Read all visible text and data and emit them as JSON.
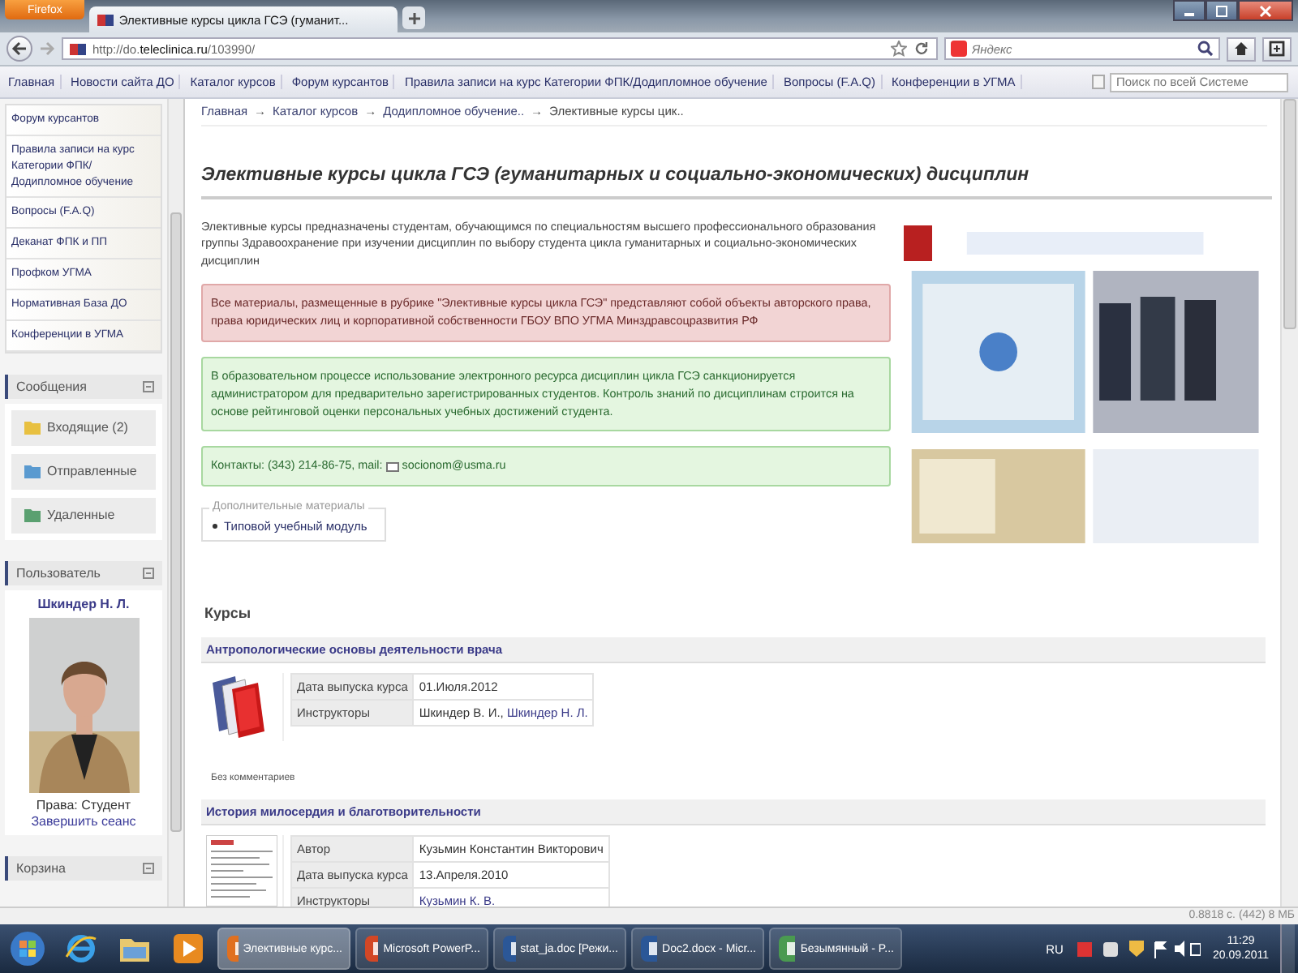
{
  "browser": {
    "menu_button": "Firefox",
    "tab_title": "Элективные курсы цикла ГСЭ (гуманит...",
    "url_plain": "http://do.",
    "url_domain": "teleclinica.ru",
    "url_path": "/103990/",
    "search_placeholder": "Яндекс"
  },
  "site_menu": {
    "items": [
      "Главная",
      "Новости сайта ДО",
      "Каталог курсов",
      "Форум курсантов",
      "Правила записи на курс Категории ФПК/Додипломное обучение",
      "Вопросы (F.A.Q)",
      "Конференции в УГМА"
    ],
    "search_placeholder": "Поиск по всей Системе"
  },
  "sidebar": {
    "links": [
      "Форум курсантов",
      "Правила записи на курс Категории ФПК/Додипломное обучение",
      "Вопросы (F.A.Q)",
      "Деканат ФПК и ПП",
      "Профком УГМА",
      "Нормативная База ДО",
      "Конференции в УГМА"
    ],
    "messages": {
      "title": "Сообщения",
      "items": [
        {
          "label": "Входящие (2)",
          "kind": "inbox"
        },
        {
          "label": "Отправленные",
          "kind": "sent"
        },
        {
          "label": "Удаленные",
          "kind": "trash"
        }
      ]
    },
    "user": {
      "title": "Пользователь",
      "name": "Шкиндер Н. Л.",
      "rights": "Права: Студент",
      "logout": "Завершить сеанс"
    },
    "basket": {
      "title": "Корзина"
    }
  },
  "breadcrumb": [
    {
      "kind": "link",
      "text": "Главная"
    },
    {
      "kind": "separator",
      "text": "→"
    },
    {
      "kind": "link",
      "text": "Каталог курсов"
    },
    {
      "kind": "separator",
      "text": "→"
    },
    {
      "kind": "link",
      "text": "Додипломное обучение.."
    },
    {
      "kind": "separator",
      "text": "→"
    },
    {
      "kind": "current",
      "text": "Элективные курсы цик.."
    }
  ],
  "heading": "Элективные курсы цикла ГСЭ (гуманитарных и социально-экономических) дисциплин",
  "intro": "Элективные курсы предназначены студентам, обучающимся по специальностям высшего профессионального образования группы Здравоохранение при изучении дисциплин по выбору студента цикла гуманитарных и социально-экономических дисциплин",
  "notices": [
    {
      "kind": "warning",
      "text": "Все материалы, размещенные в рубрике \"Элективные курсы цикла ГСЭ\" представляют собой объекты авторского права, права юридических лиц  и корпоративной собственности ГБОУ ВПО УГМА Минздравсоцразвития РФ"
    },
    {
      "kind": "info",
      "text": "В образовательном процессе использование электронного ресурса дисциплин цикла ГСЭ  санкционируется администратором для предварительно зарегистрированных студентов.  Контроль знаний по дисциплинам  строится на основе рейтинговой оценки персональных учебных достижений студента."
    },
    {
      "kind": "contact",
      "text": "Контакты: (343) 214-86-75, mail:",
      "email": "socionom@usma.ru"
    }
  ],
  "extra_materials": {
    "legend": "Дополнительные материалы",
    "items": [
      "Типовой учебный модуль"
    ]
  },
  "courses": {
    "title": "Курсы",
    "items": [
      {
        "title": "Антропологические основы деятельности врача",
        "kind": "books",
        "rows": [
          {
            "label": "Дата выпуска курса",
            "parts": [
              {
                "text": "01.Июля.2012",
                "link": false
              }
            ]
          },
          {
            "label": "Инструкторы",
            "parts": [
              {
                "text": "Шкиндер В. И., ",
                "link": false
              },
              {
                "text": "Шкиндер Н. Л.",
                "link": true
              }
            ]
          }
        ],
        "comment": "Без комментариев"
      },
      {
        "title": "История милосердия и благотворительности",
        "kind": "document",
        "rows": [
          {
            "label": "Автор",
            "parts": [
              {
                "text": "Кузьмин Константин Викторович",
                "link": false
              }
            ]
          },
          {
            "label": "Дата выпуска курса",
            "parts": [
              {
                "text": "13.Апреля.2010",
                "link": false
              }
            ]
          },
          {
            "label": "Инструкторы",
            "parts": [
              {
                "text": "Кузьмин К. В.",
                "link": true
              }
            ]
          }
        ]
      }
    ]
  },
  "status_bar": "0.8818 с. (442) 8 МБ",
  "taskbar": {
    "pinned": [
      {
        "kind": "ie"
      },
      {
        "kind": "folder"
      },
      {
        "kind": "media"
      }
    ],
    "windows": [
      {
        "label": "Элективные курс...",
        "kind": "firefox",
        "selected": true
      },
      {
        "label": "Microsoft PowerP...",
        "kind": "powerpoint",
        "selected": false
      },
      {
        "label": "stat_ja.doc [Режи...",
        "kind": "word",
        "selected": false
      },
      {
        "label": "Doc2.docx - Micr...",
        "kind": "word",
        "selected": false
      },
      {
        "label": "Безымянный - P...",
        "kind": "paint",
        "selected": false
      }
    ],
    "language": "RU",
    "time": "11:29",
    "date": "20.09.2011"
  }
}
